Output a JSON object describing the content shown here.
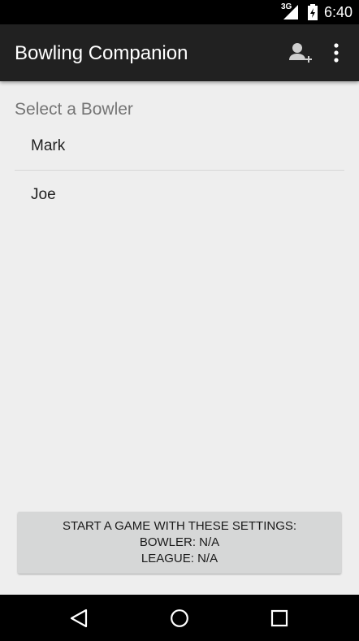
{
  "status_bar": {
    "network_label": "3G",
    "time": "6:40",
    "icons": [
      "signal-icon",
      "battery-icon"
    ]
  },
  "app_bar": {
    "title": "Bowling Companion",
    "actions": [
      "add-bowler-icon",
      "overflow-menu-icon"
    ]
  },
  "main": {
    "section_label": "Select a Bowler",
    "bowlers": [
      {
        "name": "Mark"
      },
      {
        "name": "Joe"
      }
    ]
  },
  "start_button": {
    "line1": "START A GAME WITH THESE SETTINGS:",
    "line2": "BOWLER: N/A",
    "line3": "LEAGUE: N/A"
  },
  "nav_bar": {
    "icons": [
      "back-icon",
      "home-icon",
      "recents-icon"
    ]
  },
  "colors": {
    "app_bar": "#212121",
    "background": "#eeeeee",
    "button": "#d6d7d7"
  }
}
